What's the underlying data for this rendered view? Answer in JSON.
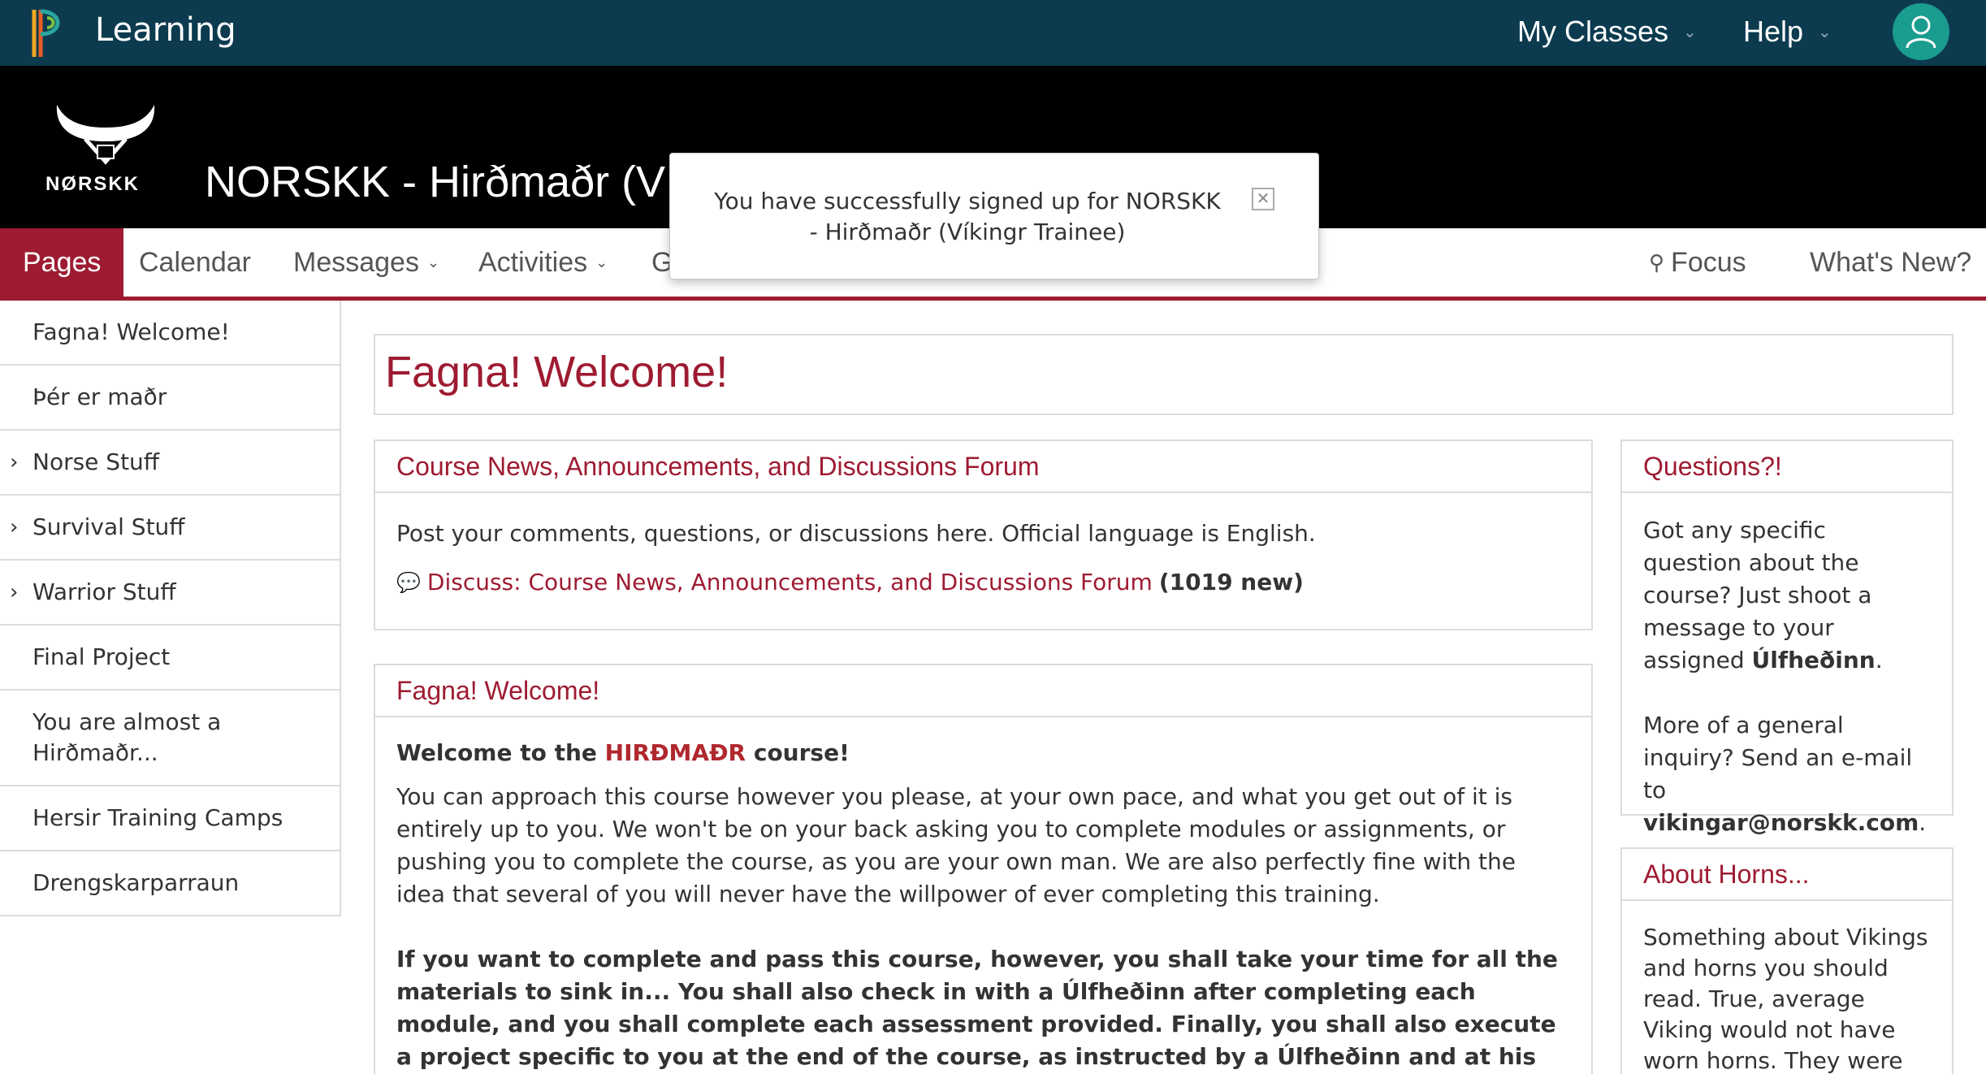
{
  "topbar": {
    "brand": "Learning",
    "my_classes": "My Classes",
    "help": "Help",
    "colors": {
      "bar": "#0c3b4f",
      "avatar": "#1a9c8f"
    }
  },
  "course": {
    "logo_text": "NØRSKK",
    "title": "NORSKK - Hirðmaðr (V"
  },
  "toast": {
    "message": "You have successfully signed up for NORSKK - Hirðmaðr (Víkingr Trainee)",
    "close_icon": "close-icon"
  },
  "tabs": {
    "pages": "Pages",
    "calendar": "Calendar",
    "messages": "Messages",
    "activities": "Activities",
    "partial": "G",
    "focus": "Focus",
    "whats_new": "What's New?"
  },
  "sidebar": {
    "items": [
      {
        "label": "Fagna! Welcome!"
      },
      {
        "label": "Þér er maðr"
      },
      {
        "label": "Norse Stuff"
      },
      {
        "label": "Survival Stuff"
      },
      {
        "label": "Warrior Stuff"
      },
      {
        "label": "Final Project"
      },
      {
        "label": "You are almost a Hirðmaðr..."
      },
      {
        "label": "Hersir Training Camps"
      },
      {
        "label": "Drengskarparraun"
      }
    ]
  },
  "main": {
    "page_title": "Fagna! Welcome!",
    "news": {
      "title": "Course News, Announcements, and Discussions Forum",
      "body": "Post your comments, questions, or discussions here. Official language is English.",
      "link": "Discuss: Course News, Announcements, and Discussions Forum",
      "new_count": "(1019 new)"
    },
    "welcome": {
      "title": "Fagna! Welcome!",
      "intro_pre": "Welcome to the ",
      "intro_highlight": "HIRÐMAÐR",
      "intro_post": " course!",
      "para1": "You can approach this course however you please, at your own pace, and what you get out of it is entirely up to you. We won't be on your back asking you to complete modules or assignments, or pushing you to complete the course, as you are your own man. We are also perfectly fine with the idea that several of you will never have the willpower of ever completing this training.",
      "para2": "If you want to complete and pass this course, however, you shall take your time for all the materials to sink in... You shall also check in with a Úlfheðinn after completing each module, and you shall complete each assessment provided. Finally, you shall also execute a project specific to you at the end of the course, as instructed by a Úlfheðinn and at his discretion."
    },
    "questions": {
      "title": "Questions?!",
      "p1_pre": "Got any specific question about the course? Just shoot a message to your assigned ",
      "p1_bold": "Úlfheðinn",
      "p1_post": ".",
      "p2_pre": "More of a general inquiry? Send an e-mail to ",
      "p2_bold": "vikingar@norskk.com",
      "p2_post": "."
    },
    "horns": {
      "title": "About Horns...",
      "body": "Something about Vikings and horns you should read. True, average Viking would not have worn horns. They were"
    }
  }
}
